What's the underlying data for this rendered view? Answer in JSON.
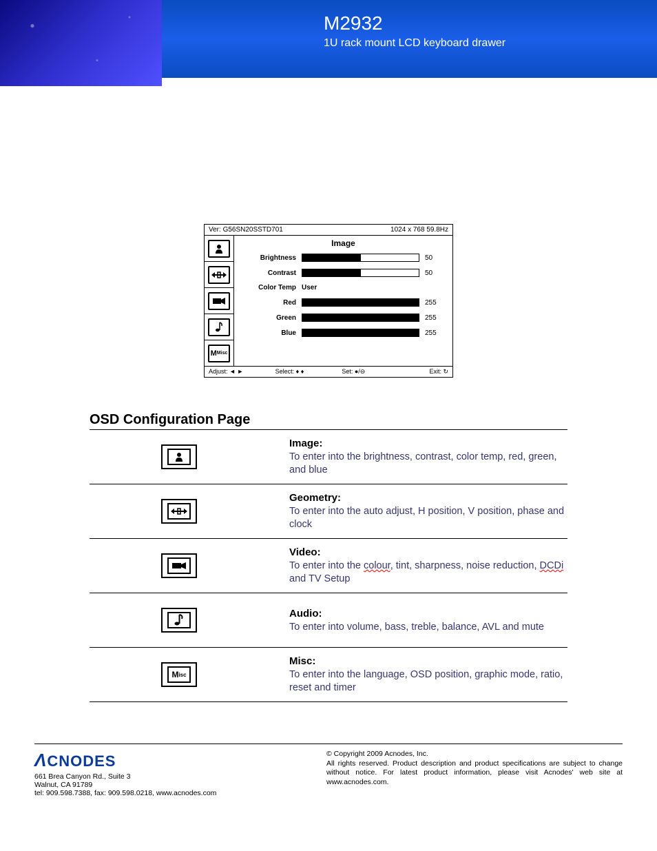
{
  "header": {
    "model": "M2932",
    "subtitle": "1U rack mount LCD keyboard drawer"
  },
  "osd": {
    "version_label": "Ver: G56SN20SSTD701",
    "resolution": "1024 x 768  59.8Hz",
    "title": "Image",
    "rows": {
      "brightness": {
        "label": "Brightness",
        "value": "50",
        "pct": 50
      },
      "contrast": {
        "label": "Contrast",
        "value": "50",
        "pct": 50
      },
      "colortemp": {
        "label": "Color Temp",
        "value": "User"
      },
      "red": {
        "label": "Red",
        "value": "255",
        "pct": 100
      },
      "green": {
        "label": "Green",
        "value": "255",
        "pct": 100
      },
      "blue": {
        "label": "Blue",
        "value": "255",
        "pct": 100
      }
    },
    "footer": {
      "adjust": "Adjust: ◄ ►",
      "select": "Select: ♦ ♦",
      "set": "Set: ●/⊖",
      "exit": "Exit: ↻"
    },
    "tabs": {
      "misc_label": "Misc"
    }
  },
  "config": {
    "title": "OSD Configuration Page",
    "rows": [
      {
        "heading": "Image:",
        "desc_pre": "To enter into the brightness, contrast, color temp, red, green, and blue",
        "icon": "person"
      },
      {
        "heading": "Geometry:",
        "desc_pre": "To enter into the auto adjust, H position, V position, phase and clock",
        "icon": "arrows"
      },
      {
        "heading": "Video:",
        "desc_pre": "To enter into the ",
        "wavy1": "colour",
        "mid": ", tint, sharpness, noise reduction, ",
        "wavy2": "DCDi",
        "desc_post": " and TV Setup",
        "icon": "camera"
      },
      {
        "heading": "Audio:",
        "desc_pre": "To enter into volume, bass, treble, balance, AVL and mute",
        "icon": "note"
      },
      {
        "heading": "Misc:",
        "desc_pre": "To enter into the language, OSD position, graphic mode, ratio, reset and timer",
        "icon": "misc"
      }
    ]
  },
  "footer": {
    "logo": "CNODES",
    "addr1": "661 Brea Canyon Rd., Suite 3",
    "addr2": "Walnut, CA 91789",
    "addr3": "tel: 909.598.7388, fax: 909.598.0218, www.acnodes.com",
    "copy": "© Copyright 2009 Acnodes, Inc.",
    "legal": "All rights reserved. Product description and product specifications are subject to change without notice. For latest product information, please visit Acnodes' web site at www.acnodes.com."
  }
}
